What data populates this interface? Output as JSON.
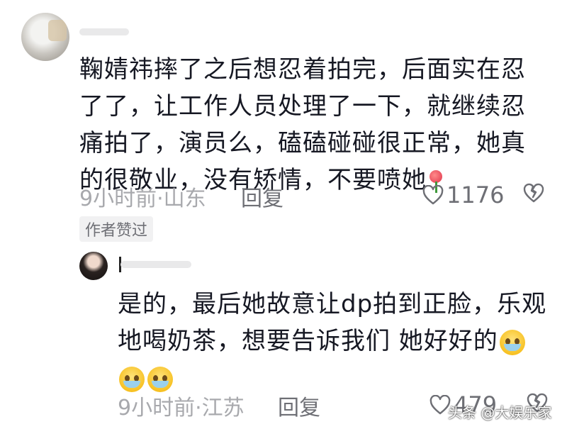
{
  "comment_1": {
    "text": "鞠婧祎摔了之后想忍着拍完，后面实在忍了了，让工作人员处理了一下，就继续忍痛拍了，演员么，磕磕碰碰很正常，她真的很敬业，没有矫情，不要喷她",
    "emoji": "rose-icon",
    "time_location": "9小时前·山东",
    "reply_label": "回复",
    "likes": "1176",
    "badge": "作者赞过"
  },
  "comment_2": {
    "text": "是的，最后她故意让dp拍到正脸，乐观地喝奶茶，想要告诉我们 她好好的",
    "emoji": "crying-face-icon",
    "time_location": "9小时前·江苏",
    "reply_label": "回复",
    "likes": "479"
  },
  "watermark": "头条 @大娱乐家",
  "colors": {
    "text": "#161823",
    "meta": "#a8a9ad",
    "action": "#6e6f75",
    "badge_bg": "#f1f1f2"
  }
}
